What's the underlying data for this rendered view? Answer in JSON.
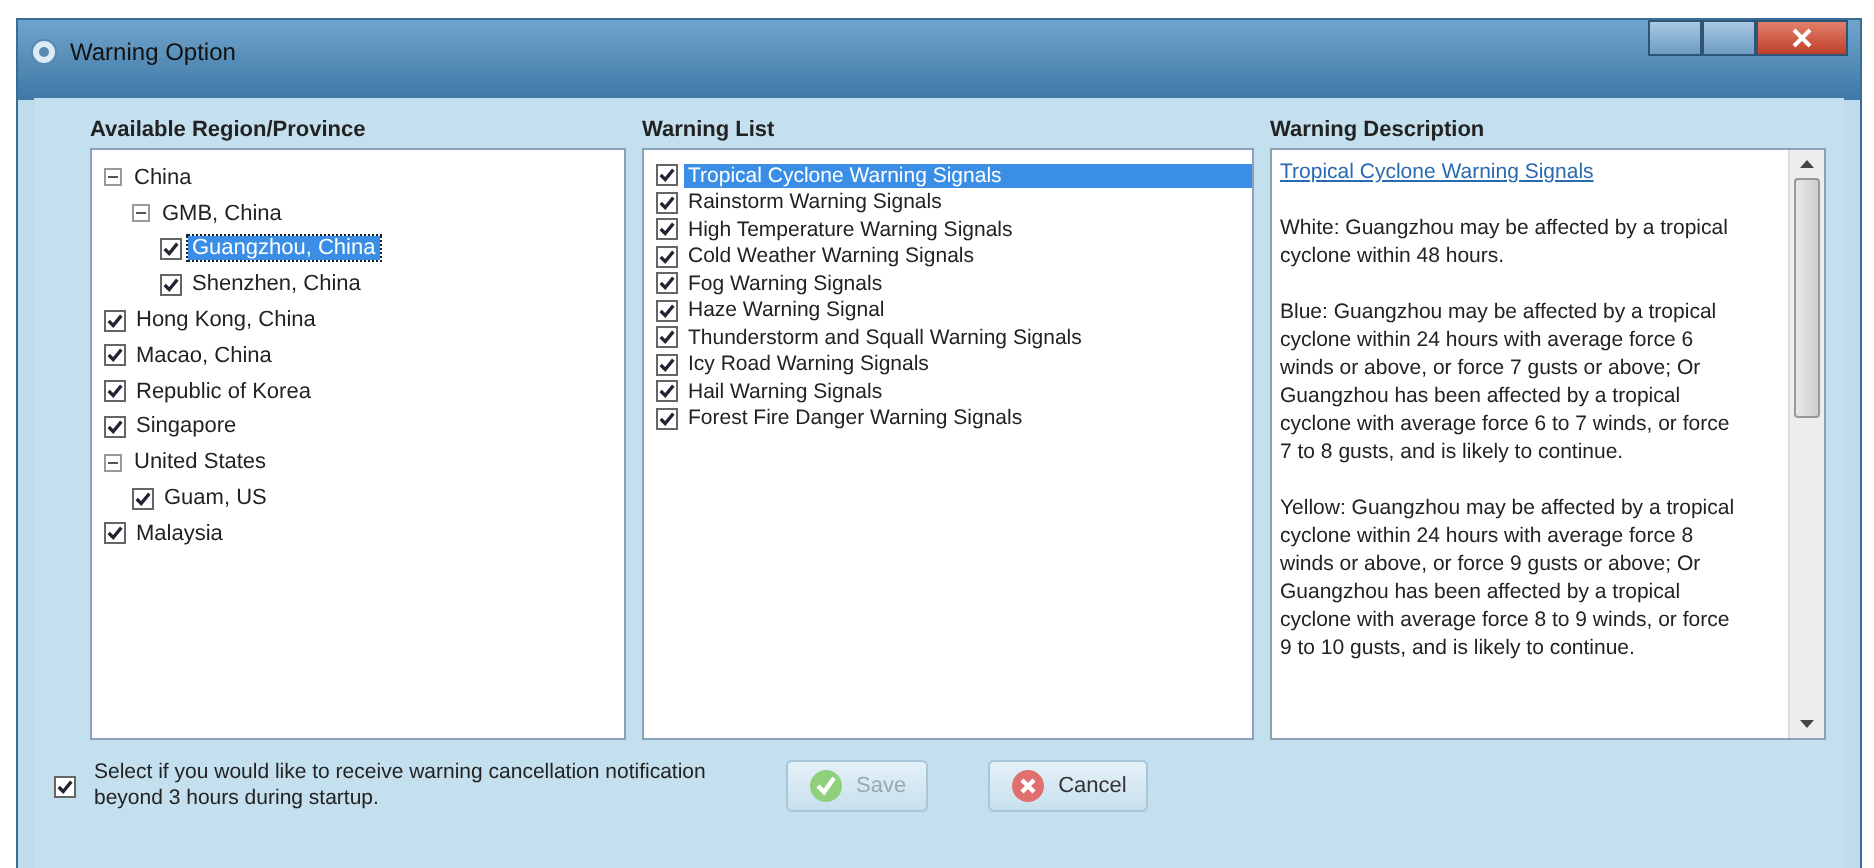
{
  "window": {
    "title": "Warning Option"
  },
  "regions": {
    "header": "Available Region/Province",
    "items": [
      {
        "label": "China",
        "kind": "group",
        "expanded": true,
        "selected": false,
        "children": [
          {
            "label": "GMB, China",
            "kind": "group",
            "expanded": true,
            "selected": false,
            "children": [
              {
                "label": "Guangzhou, China",
                "kind": "region",
                "checked": true,
                "selected": true
              },
              {
                "label": "Shenzhen, China",
                "kind": "region",
                "checked": true,
                "selected": false
              }
            ]
          }
        ]
      },
      {
        "label": "Hong Kong, China",
        "kind": "region",
        "checked": true,
        "selected": false
      },
      {
        "label": "Macao, China",
        "kind": "region",
        "checked": true,
        "selected": false
      },
      {
        "label": "Republic of Korea",
        "kind": "region",
        "checked": true,
        "selected": false
      },
      {
        "label": "Singapore",
        "kind": "region",
        "checked": true,
        "selected": false
      },
      {
        "label": "United States",
        "kind": "group",
        "expanded": true,
        "selected": false,
        "children": [
          {
            "label": "Guam, US",
            "kind": "region",
            "checked": true,
            "selected": false
          }
        ]
      },
      {
        "label": "Malaysia",
        "kind": "region",
        "checked": true,
        "selected": false
      }
    ]
  },
  "warnings": {
    "header": "Warning List",
    "items": [
      {
        "label": "Tropical Cyclone Warning Signals",
        "checked": true,
        "selected": true
      },
      {
        "label": "Rainstorm Warning Signals",
        "checked": true,
        "selected": false
      },
      {
        "label": "High Temperature Warning Signals",
        "checked": true,
        "selected": false
      },
      {
        "label": "Cold Weather Warning Signals",
        "checked": true,
        "selected": false
      },
      {
        "label": "Fog Warning Signals",
        "checked": true,
        "selected": false
      },
      {
        "label": "Haze Warning Signal",
        "checked": true,
        "selected": false
      },
      {
        "label": "Thunderstorm and Squall Warning Signals",
        "checked": true,
        "selected": false
      },
      {
        "label": "Icy Road Warning Signals",
        "checked": true,
        "selected": false
      },
      {
        "label": "Hail Warning Signals",
        "checked": true,
        "selected": false
      },
      {
        "label": "Forest Fire Danger Warning Signals",
        "checked": true,
        "selected": false
      }
    ]
  },
  "description": {
    "header": "Warning Description",
    "link": "Tropical Cyclone Warning Signals",
    "paragraphs": [
      "White: Guangzhou may be affected by a tropical cyclone within 48 hours.",
      "Blue: Guangzhou may be affected by a tropical cyclone within 24 hours with average force 6 winds or above, or force 7 gusts or above; Or Guangzhou has been affected by a tropical cyclone with average force 6 to 7 winds, or force 7 to 8 gusts, and is likely to continue.",
      "Yellow: Guangzhou may be affected by a tropical cyclone within 24 hours with average force 8 winds or above, or force 9 gusts or above; Or Guangzhou has been affected by a tropical cyclone with average force 8 to 9 winds, or force 9 to 10 gusts, and is likely to continue."
    ]
  },
  "footer": {
    "option": {
      "label": "Select if you would like to receive warning cancellation notification beyond 3 hours during startup.",
      "checked": true
    },
    "buttons": [
      {
        "label": "Save",
        "kind": "save",
        "disabled": true
      },
      {
        "label": "Cancel",
        "kind": "cancel",
        "disabled": false
      }
    ]
  }
}
